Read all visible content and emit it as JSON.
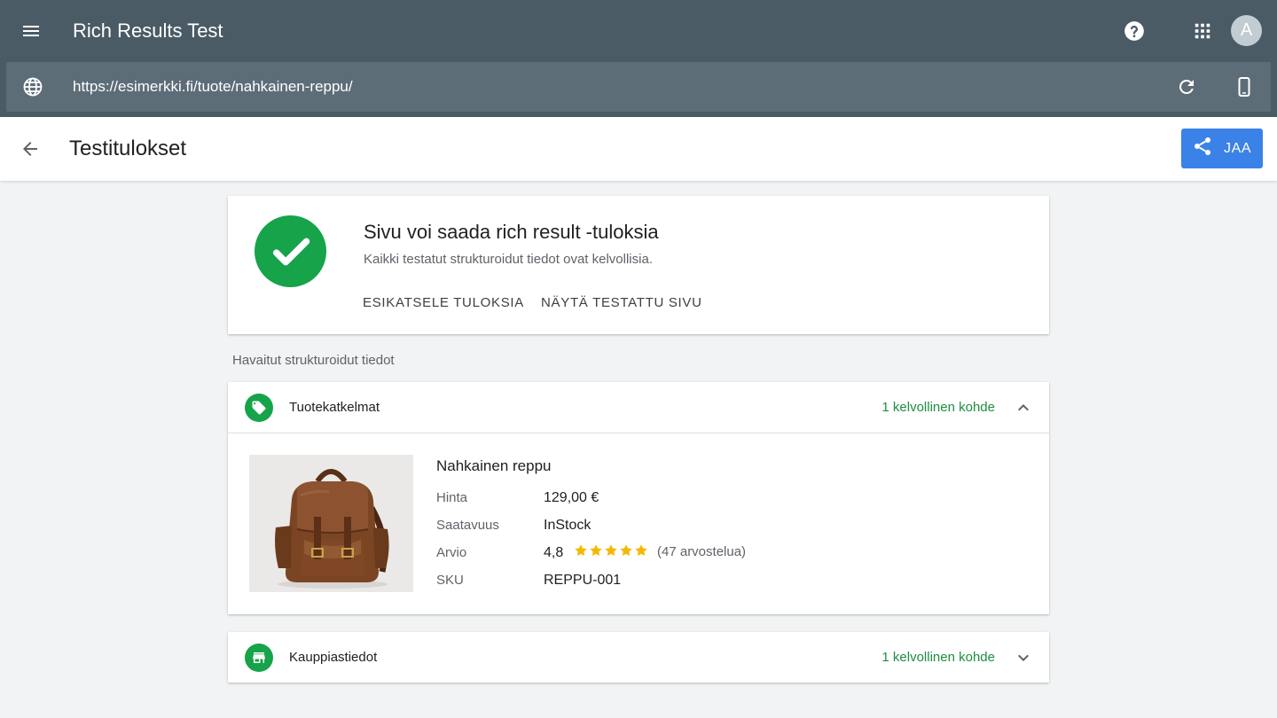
{
  "app": {
    "title": "Rich Results Test",
    "avatar_letter": "A",
    "icons": {
      "menu": "menu-icon",
      "help": "help-icon",
      "apps": "apps-grid-icon"
    }
  },
  "urlbar": {
    "url": "https://esimerkki.fi/tuote/nahkainen-reppu/",
    "icons": {
      "globe": "globe-icon",
      "refresh": "refresh-icon",
      "device": "smartphone-icon"
    }
  },
  "subheader": {
    "title": "Testitulokset",
    "share_label": "JAA",
    "icons": {
      "back": "arrow-back-icon",
      "share": "share-icon"
    }
  },
  "summary": {
    "title": "Sivu voi saada rich result -tuloksia",
    "subtitle": "Kaikki testatut strukturoidut tiedot ovat kelvollisia.",
    "preview_label": "ESIKATSELE TULOKSIA",
    "tested_page_label": "NÄYTÄ TESTATTU SIVU",
    "status_icon": "check-circle-icon"
  },
  "detected_label": "Havaitut strukturoidut tiedot",
  "groups": [
    {
      "name": "Tuotekatkelmat",
      "count": "1 kelvollinen kohde",
      "icon": "tag-icon",
      "expanded": true,
      "item": {
        "name": "Nahkainen reppu",
        "image": "backpack-image",
        "props": [
          {
            "key": "Hinta",
            "value": "129,00 €"
          },
          {
            "key": "Saatavuus",
            "value": "InStock"
          },
          {
            "key": "Arvio",
            "value": "4,8"
          },
          {
            "key": "SKU",
            "value": "REPPU-001"
          }
        ],
        "stars": 5,
        "reviews": "(47 arvostelua)"
      }
    },
    {
      "name": "Kauppiastiedot",
      "count": "1 kelvollinen kohde",
      "icon": "store-icon",
      "expanded": false
    }
  ],
  "colors": {
    "appbar": "#4a5b66",
    "urlbar": "#5d6d78",
    "accent": "#3b82e8",
    "success": "#16a34a",
    "success_text": "#1e8e3e",
    "star": "#f5b800"
  }
}
